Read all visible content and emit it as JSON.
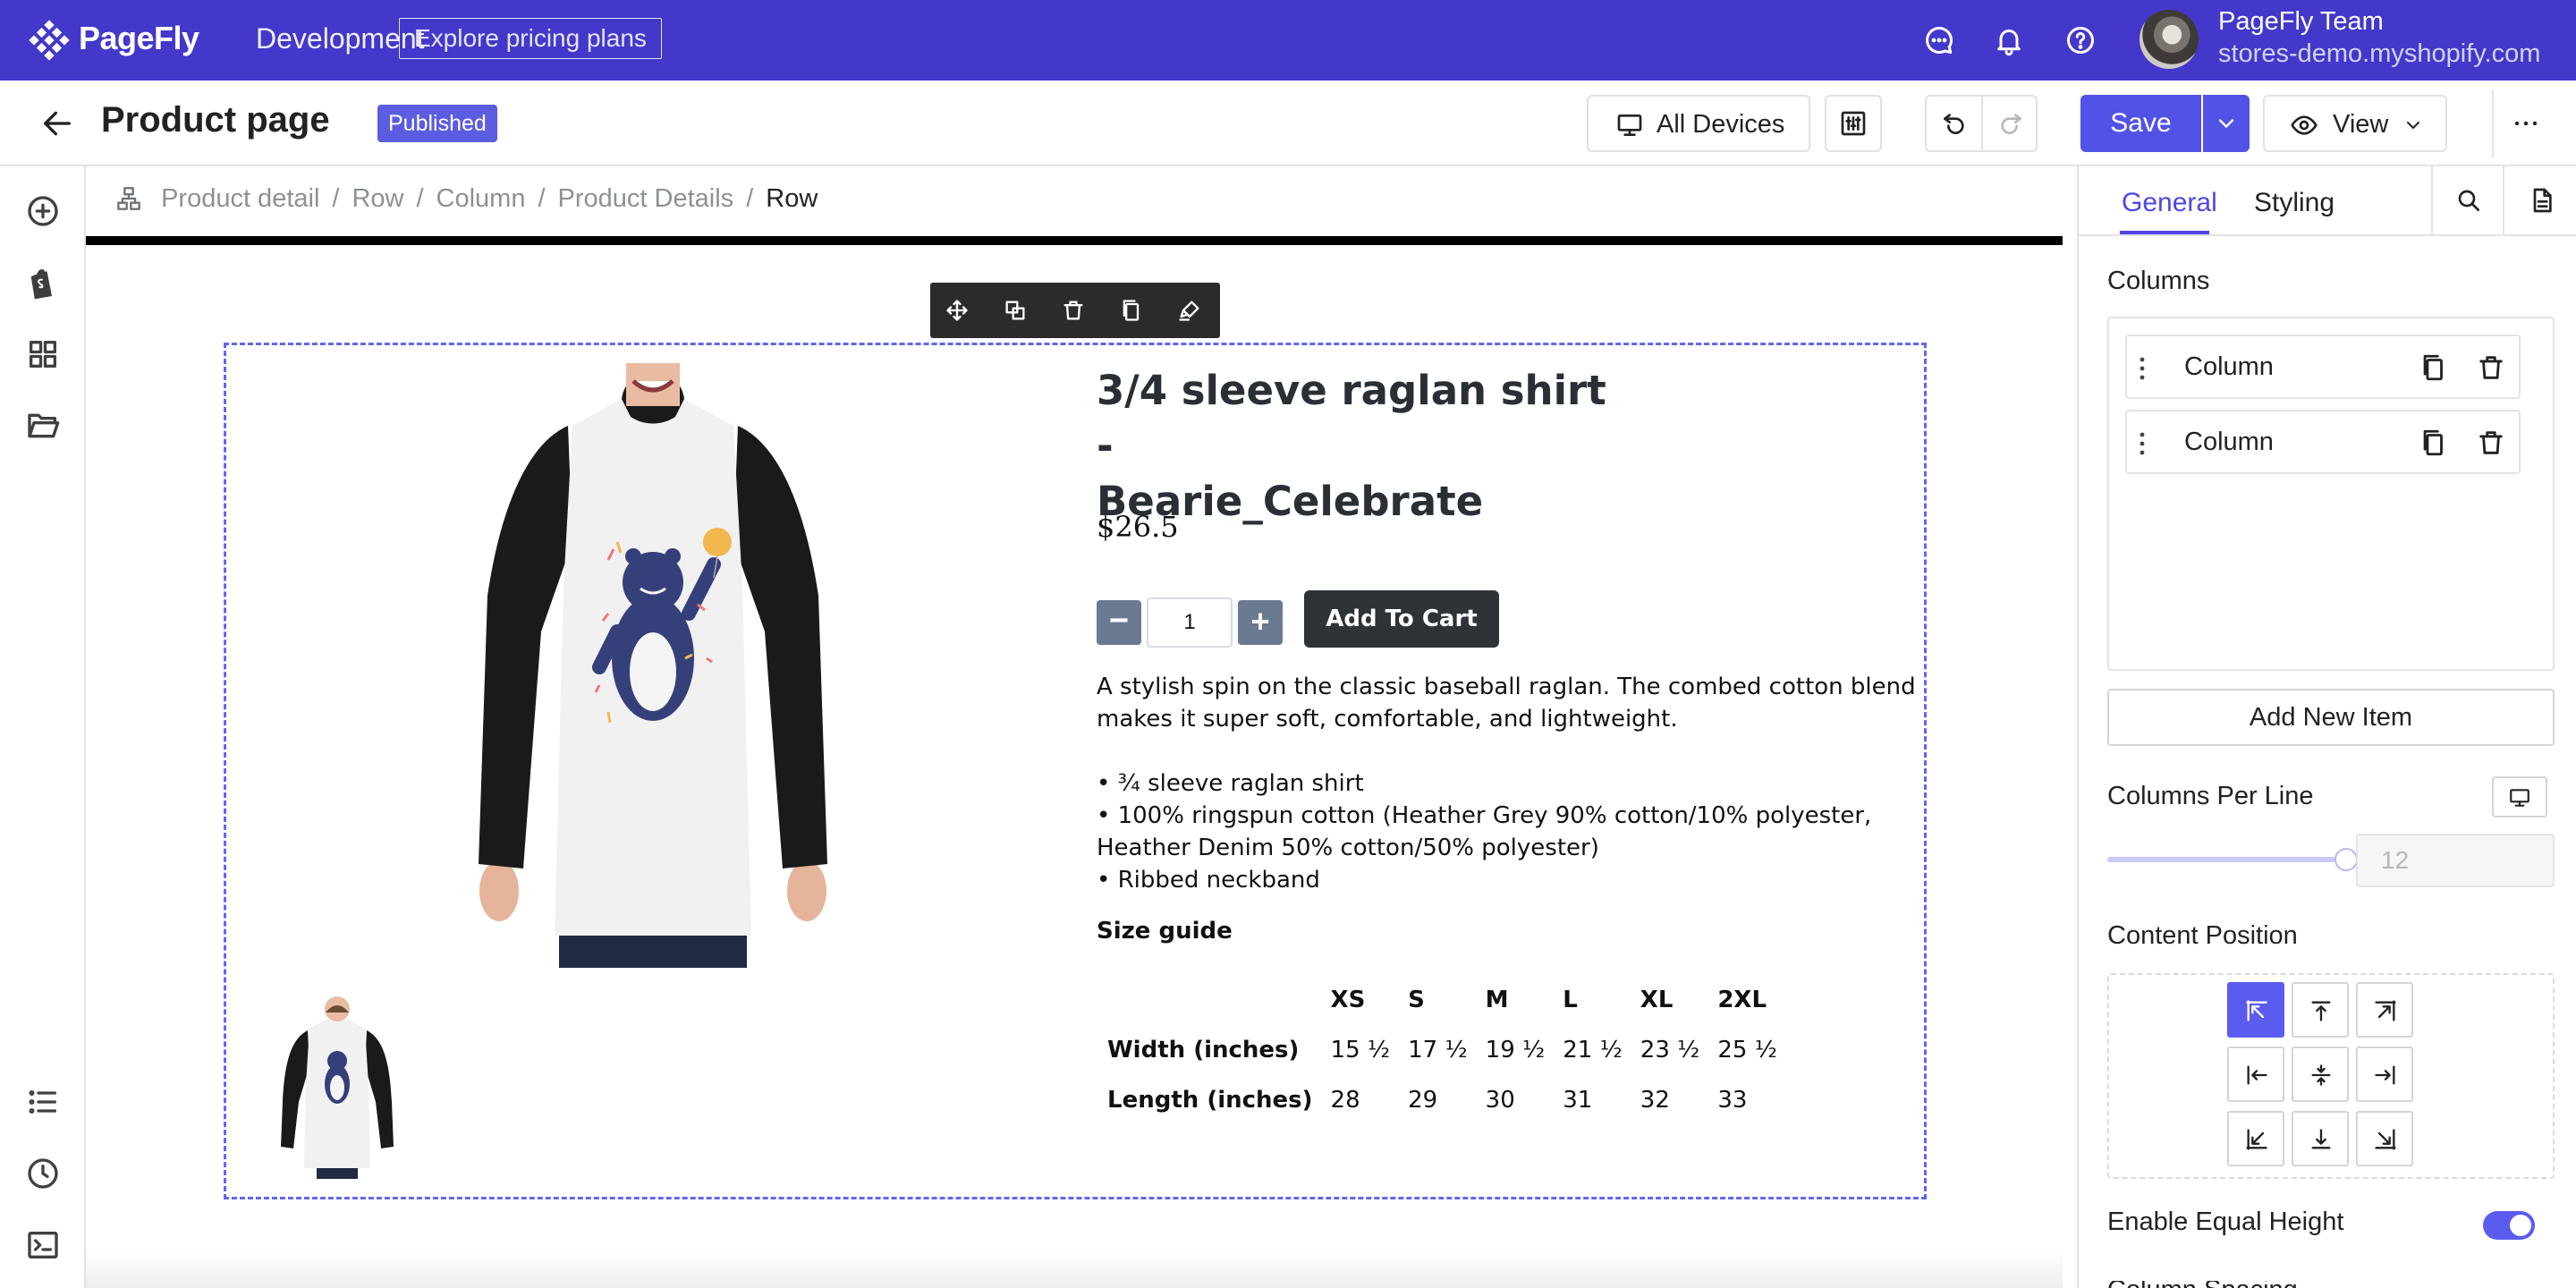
{
  "topbar": {
    "brand_name": "PageFly",
    "brand_env": "Development",
    "pricing_label": "Explore pricing plans",
    "team_name": "PageFly Team",
    "team_store": "stores-demo.myshopify.com",
    "icons": [
      "chat-icon",
      "bell-icon",
      "help-icon"
    ]
  },
  "header": {
    "page_title": "Product page",
    "status": "Published",
    "devices_label": "All Devices",
    "save_label": "Save",
    "view_label": "View"
  },
  "breadcrumb": {
    "items": [
      "Product detail",
      "Row",
      "Column",
      "Product Details"
    ],
    "current": "Row",
    "separator": "/"
  },
  "product": {
    "title_line1": "3/4 sleeve raglan shirt -",
    "title_line2": "Bearie_Celebrate",
    "price": "$26.5",
    "quantity": "1",
    "minus": "−",
    "plus": "+",
    "add_to_cart": "Add To Cart",
    "description": "A stylish spin on the classic baseball raglan. The combed cotton blend makes it super soft, comfortable, and lightweight.",
    "bullets": [
      "• ¾ sleeve raglan shirt",
      "• 100% ringspun cotton (Heather Grey 90% cotton/10% polyester, Heather Denim 50% cotton/50% polyester)",
      "• Ribbed neckband"
    ],
    "size_guide_title": "Size guide",
    "size_table": {
      "headers": [
        "",
        "XS",
        "S",
        "M",
        "L",
        "XL",
        "2XL"
      ],
      "rows": [
        {
          "label": "Width (inches)",
          "values": [
            "15 ½",
            "17 ½",
            "19 ½",
            "21 ½",
            "23 ½",
            "25 ½"
          ]
        },
        {
          "label": "Length (inches)",
          "values": [
            "28",
            "29",
            "30",
            "31",
            "32",
            "33"
          ]
        }
      ]
    }
  },
  "panel": {
    "tab_general": "General",
    "tab_styling": "Styling",
    "columns_label": "Columns",
    "columns": [
      "Column",
      "Column"
    ],
    "add_item": "Add New Item",
    "columns_per_line_label": "Columns Per Line",
    "columns_per_line_value": "12",
    "content_position_label": "Content Position",
    "active_position": "top-left",
    "equal_height_label": "Enable Equal Height",
    "equal_height_on": true,
    "next_label": "Column Spacing"
  },
  "colors": {
    "topbar": "#4338ca",
    "accent": "#5252e6",
    "status_badge": "#5c5ce0",
    "selection_outline": "#6366f1"
  }
}
